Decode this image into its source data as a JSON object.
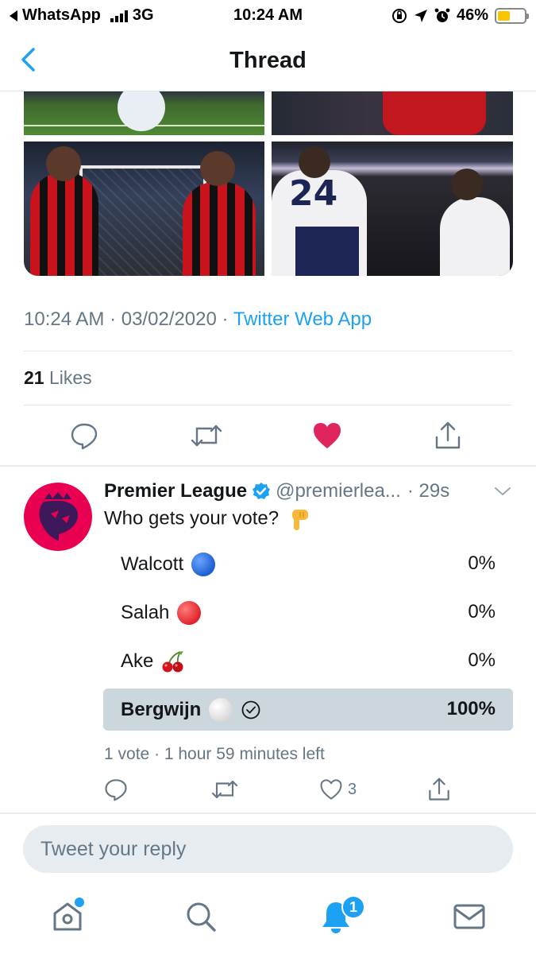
{
  "status_bar": {
    "carrier": "WhatsApp",
    "network": "3G",
    "time": "10:24 AM",
    "battery": "46%",
    "battery_level": 0.46,
    "battery_color": "#f7c600"
  },
  "nav": {
    "back_icon": "chevron-left-icon",
    "title": "Thread"
  },
  "tweet": {
    "time": "10:24 AM",
    "date": "03/02/2020",
    "source": "Twitter Web App",
    "likes_count": "21",
    "likes_label": "Likes",
    "actions": [
      "reply-icon",
      "retweet-icon",
      "heart-filled-icon",
      "share-icon"
    ]
  },
  "reply_tweet": {
    "name": "Premier League",
    "handle": "@premierlea...",
    "time": "· 29s",
    "text": "Who gets your vote?",
    "poll": {
      "options": [
        {
          "label": "Walcott",
          "emoji_color": "#1e5fd0",
          "pct": "0%",
          "fraction": 0
        },
        {
          "label": "Salah",
          "emoji_color": "#e0232b",
          "pct": "0%",
          "fraction": 0
        },
        {
          "label": "Ake",
          "emoji": "cherries",
          "pct": "0%",
          "fraction": 0
        },
        {
          "label": "Bergwijn",
          "emoji_color": "#e8e8e8",
          "pct": "100%",
          "fraction": 1,
          "selected": true
        }
      ],
      "info": "1 vote · 1 hour 59 minutes left"
    },
    "like_count": "3"
  },
  "reply_box": {
    "placeholder": "Tweet your reply"
  },
  "tab_bar": {
    "items": [
      "home-icon",
      "search-icon",
      "notifications-icon",
      "messages-icon"
    ],
    "notification_badge": "1"
  },
  "colors": {
    "accent": "#1da1f2",
    "like_red": "#e0245e",
    "muted": "#657786",
    "pl_pink": "#e90052"
  }
}
